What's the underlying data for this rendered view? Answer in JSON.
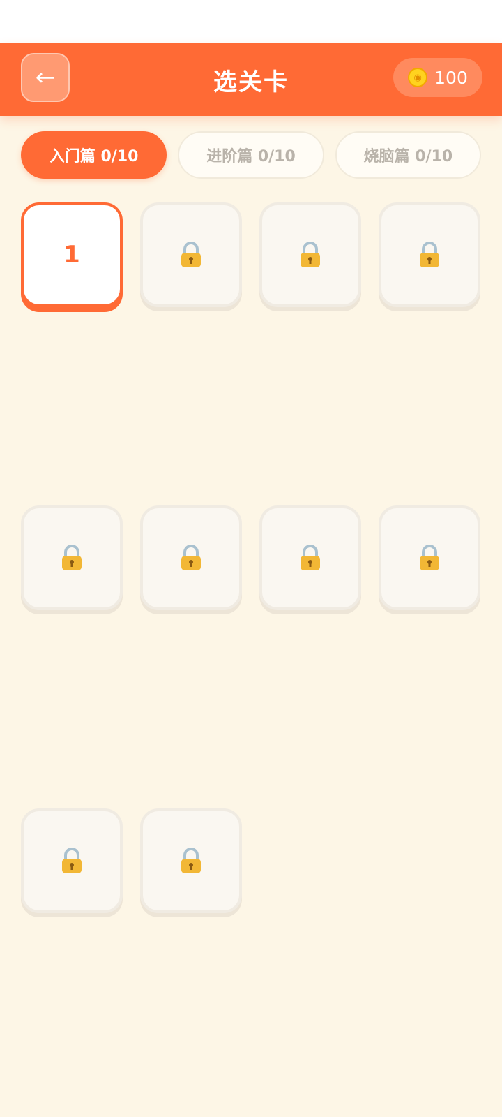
{
  "header": {
    "back_icon": "←",
    "title": "选关卡",
    "coin_count": "100"
  },
  "tabs": [
    {
      "label": "入门篇 0/10",
      "active": true
    },
    {
      "label": "进阶篇 0/10",
      "active": false
    },
    {
      "label": "烧脑篇 0/10",
      "active": false
    }
  ],
  "levels": [
    {
      "number": "1",
      "locked": false
    },
    {
      "number": "",
      "locked": true
    },
    {
      "number": "",
      "locked": true
    },
    {
      "number": "",
      "locked": true
    },
    {
      "number": "",
      "locked": true
    },
    {
      "number": "",
      "locked": true
    },
    {
      "number": "",
      "locked": true
    },
    {
      "number": "",
      "locked": true
    },
    {
      "number": "",
      "locked": true
    },
    {
      "number": "",
      "locked": true
    }
  ],
  "icons": {
    "back": "arrow-left-icon",
    "coin": "coin-icon",
    "lock": "lock-icon"
  },
  "colors": {
    "accent": "#ff6a35",
    "background": "#fdf6e6",
    "locked_tile": "#faf7f1",
    "coin": "#ffd21f",
    "lock_body": "#f2b735"
  }
}
